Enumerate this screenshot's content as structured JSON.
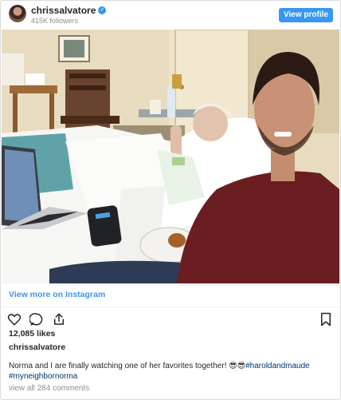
{
  "header": {
    "username": "chrissalvatore",
    "followers": "415K followers",
    "view_profile_label": "View profile",
    "verified_mark": "✓"
  },
  "post": {
    "view_more_label": "View more on Instagram",
    "likes": "12,085 likes",
    "caption_user": "chrissalvatore",
    "caption_text": "Norma and I are finally watching one of her favorites together! ",
    "caption_emoji": "😎😎",
    "caption_tag1": "#haroldandmaude",
    "caption_tag2": "#myneighbornorma",
    "comments_label": "view all 284 comments"
  },
  "icons": {
    "like": "heart-icon",
    "comment": "comment-icon",
    "share": "share-icon",
    "save": "bookmark-icon"
  },
  "colors": {
    "accent": "#3897f0",
    "text": "#262626",
    "muted": "#8e8e8e",
    "hashtag": "#003569"
  }
}
